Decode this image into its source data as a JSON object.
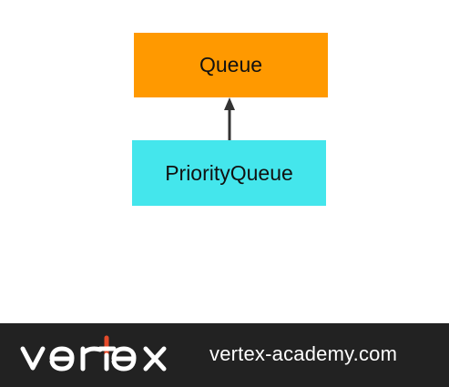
{
  "diagram": {
    "parent_class": {
      "label": "Queue",
      "color": "#ff9900"
    },
    "child_class": {
      "label": "PriorityQueue",
      "color": "#44e6ec"
    },
    "relationship": {
      "type": "inheritance",
      "icon": "arrow-up-icon",
      "color": "#333333"
    }
  },
  "footer": {
    "brand": "vertex",
    "brand_accent_color": "#e54b2b",
    "site": "vertex-academy.com",
    "background_color": "#222222"
  }
}
